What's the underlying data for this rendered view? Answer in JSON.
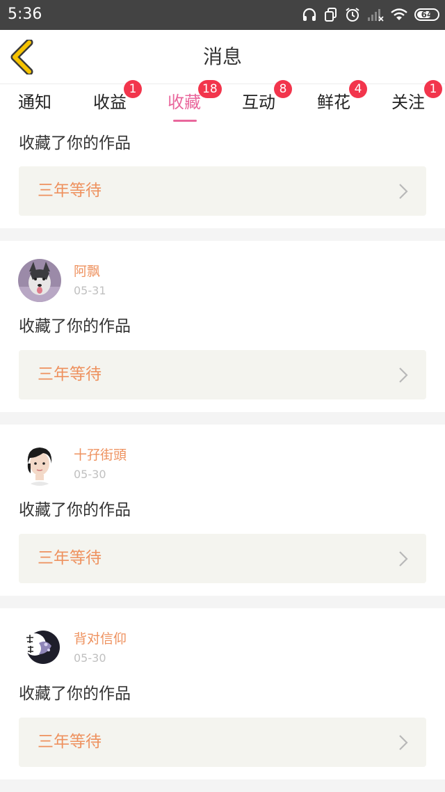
{
  "status_bar": {
    "time": "5:36",
    "battery": "64",
    "icons": [
      "headphones-icon",
      "copy-icon",
      "alarm-icon",
      "signal-icon",
      "wifi-icon",
      "battery-icon"
    ]
  },
  "header": {
    "title": "消息",
    "back_icon": "back-chevron-icon"
  },
  "tabs": [
    {
      "label": "通知",
      "badge": ""
    },
    {
      "label": "收益",
      "badge": "1"
    },
    {
      "label": "收藏",
      "badge": "18",
      "active": true
    },
    {
      "label": "互动",
      "badge": "8"
    },
    {
      "label": "鲜花",
      "badge": "4"
    },
    {
      "label": "关注",
      "badge": "1"
    }
  ],
  "feed": [
    {
      "user": "",
      "date": "",
      "action": "收藏了你的作品",
      "work": "三年等待"
    },
    {
      "user": "阿飘",
      "date": "05-31",
      "action": "收藏了你的作品",
      "work": "三年等待"
    },
    {
      "user": "十孖街頭",
      "date": "05-30",
      "action": "收藏了你的作品",
      "work": "三年等待"
    },
    {
      "user": "背对信仰",
      "date": "05-30",
      "action": "收藏了你的作品",
      "work": "三年等待"
    }
  ],
  "colors": {
    "accent_pink": "#e9679c",
    "badge_red": "#f2354c",
    "name_orange": "#ee915e",
    "back_yellow": "#f6c300",
    "separator": "#f4f4f4",
    "work_box": "#f4f4ef"
  }
}
